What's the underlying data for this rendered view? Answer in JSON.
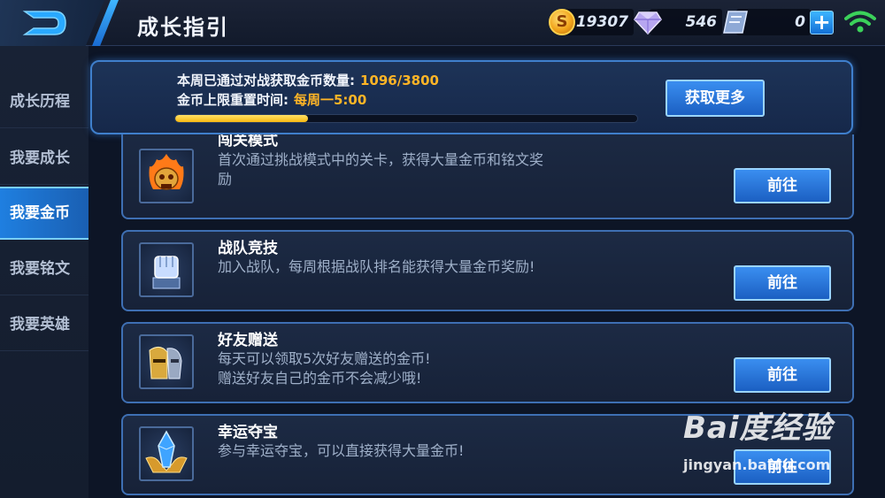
{
  "header": {
    "title": "成长指引",
    "gold": "19307",
    "diamonds": "546",
    "vouchers": "0"
  },
  "sidebar": {
    "items": [
      {
        "label": "成长历程"
      },
      {
        "label": "我要成长"
      },
      {
        "label": "我要金币",
        "active": true
      },
      {
        "label": "我要铭文"
      },
      {
        "label": "我要英雄"
      }
    ]
  },
  "progress": {
    "line1_label": "本周已通过对战获取金币数量:",
    "line1_value": "1096/3800",
    "line2_label": "金币上限重置时间:",
    "line2_value": "每周一5:00",
    "fraction": 0.288,
    "more_label": "获取更多"
  },
  "tasks": [
    {
      "title": "闯关模式",
      "desc": "首次通过挑战模式中的关卡，获得大量金币和铭文奖励",
      "button": "前往",
      "icon": "flaming-skull-icon"
    },
    {
      "title": "战队竞技",
      "desc": "加入战队，每周根据战队排名能获得大量金币奖励!",
      "button": "前往",
      "icon": "raised-fist-icon"
    },
    {
      "title": "好友赠送",
      "desc_line1": "每天可以领取5次好友赠送的金币!",
      "desc_line2": "赠送好友自己的金币不会减少哦!",
      "button": "前往",
      "icon": "two-knights-icon"
    },
    {
      "title": "幸运夺宝",
      "desc": "参与幸运夺宝，可以直接获得大量金币!",
      "button": "前往",
      "icon": "blue-crystal-icon"
    }
  ],
  "watermark": {
    "brand": "Bai度经验",
    "url": "jingyan.baidu.com"
  },
  "colors": {
    "accent": "#2f86e8",
    "highlight": "#ffb526",
    "panel_border": "#3e6fb3"
  }
}
